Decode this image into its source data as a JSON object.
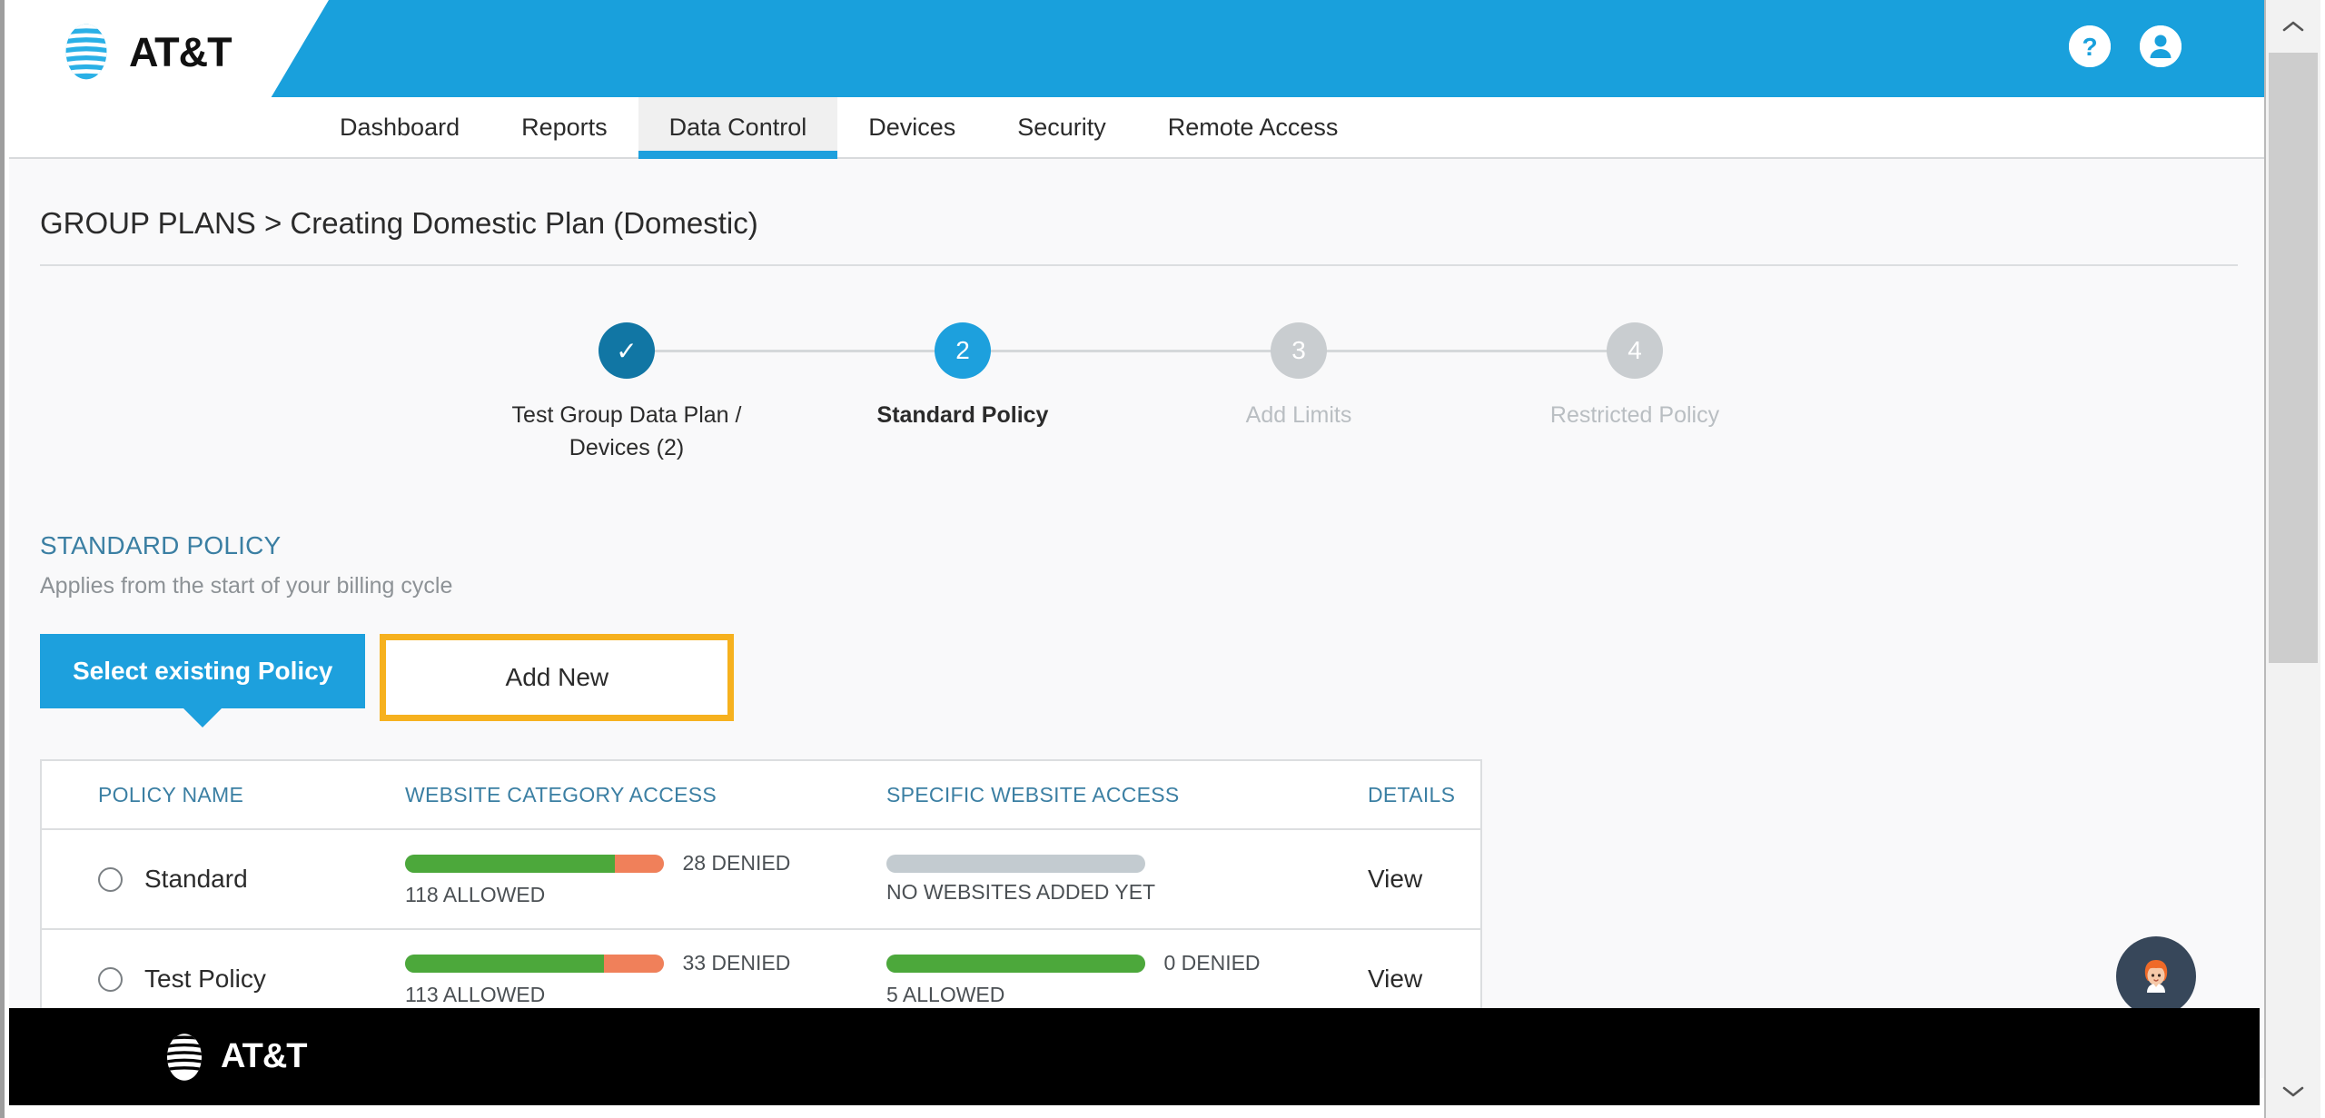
{
  "brand": {
    "name": "AT&T",
    "accent_blue": "#1da0dd",
    "dark_blue": "#1176a4",
    "highlight_orange": "#f6b11e",
    "allowed_green": "#4ca83b",
    "denied_orange": "#f0805a"
  },
  "header": {
    "logo_text": "AT&T",
    "help_icon": "help-icon",
    "account_icon": "account-icon"
  },
  "nav": {
    "items": [
      {
        "label": "Dashboard",
        "active": false
      },
      {
        "label": "Reports",
        "active": false
      },
      {
        "label": "Data Control",
        "active": true
      },
      {
        "label": "Devices",
        "active": false
      },
      {
        "label": "Security",
        "active": false
      },
      {
        "label": "Remote Access",
        "active": false
      }
    ]
  },
  "breadcrumb": {
    "text": "GROUP PLANS > Creating Domestic Plan (Domestic)"
  },
  "stepper": {
    "steps": [
      {
        "marker": "✓",
        "label": "Test Group Data Plan / Devices (2)",
        "state": "done"
      },
      {
        "marker": "2",
        "label": "Standard Policy",
        "state": "current"
      },
      {
        "marker": "3",
        "label": "Add Limits",
        "state": "todo"
      },
      {
        "marker": "4",
        "label": "Restricted Policy",
        "state": "todo"
      }
    ]
  },
  "standard_policy": {
    "title": "STANDARD POLICY",
    "subtitle": "Applies from the start of your billing cycle",
    "tabs": {
      "select_existing": "Select existing Policy",
      "add_new": "Add New"
    }
  },
  "policy_table": {
    "headers": {
      "name": "POLICY NAME",
      "category_access": "WEBSITE CATEGORY ACCESS",
      "site_access": "SPECIFIC WEBSITE ACCESS",
      "details": "DETAILS"
    },
    "rows": [
      {
        "name": "Standard",
        "selected": false,
        "category": {
          "allowed": 118,
          "denied": 28,
          "allowed_label": "118 ALLOWED",
          "denied_label": "28 DENIED",
          "allowed_pct": 81
        },
        "site": {
          "empty": true,
          "empty_label": "NO WEBSITES ADDED YET",
          "allowed_label": "",
          "denied_label": "",
          "allowed_pct": 0
        },
        "details_label": "View"
      },
      {
        "name": "Test Policy",
        "selected": false,
        "category": {
          "allowed": 113,
          "denied": 33,
          "allowed_label": "113 ALLOWED",
          "denied_label": "33 DENIED",
          "allowed_pct": 77
        },
        "site": {
          "empty": false,
          "empty_label": "",
          "allowed_label": "5 ALLOWED",
          "denied_label": "0 DENIED",
          "allowed_pct": 100
        },
        "details_label": "View"
      }
    ]
  },
  "chat": {
    "label": "virtual-assistant"
  },
  "footer": {
    "logo_text": "AT&T"
  },
  "scrollbar": {
    "up_arrow": "⌃",
    "down_arrow": "⌄"
  }
}
